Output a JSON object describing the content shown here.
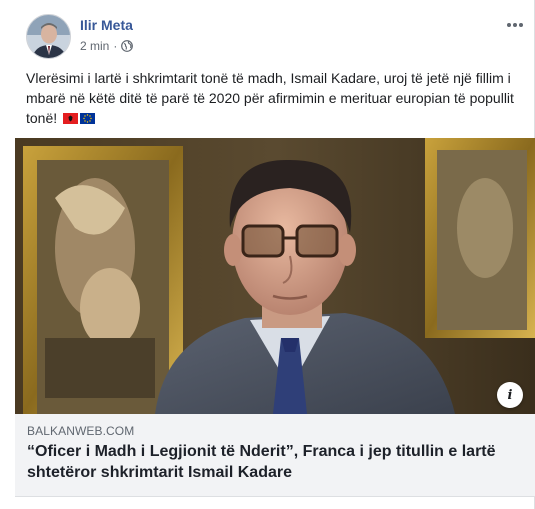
{
  "post": {
    "author": "Ilir Meta",
    "timestamp": "2 min",
    "separator": "·",
    "privacy_icon": "globe-icon",
    "more_icon": "more-options-icon",
    "text": "Vlerësimi i lartë i shkrimtarit tonë të madh, Ismail Kadare, uroj të jetë një fillim i mbarë në këtë ditë të parë të 2020 për afirmimin e merituar europian të popullit tonë!",
    "emoji": [
      "flag-albania",
      "flag-european-union"
    ]
  },
  "link_preview": {
    "domain": "BALKANWEB.COM",
    "headline": "“Oficer i Madh i Legjionit të Nderit”, Franca i jep titullin e lartë shtetëror shkrimtarit Ismail Kadare",
    "info_label": "i"
  },
  "colors": {
    "author_link": "#385898",
    "meta_text": "#606770",
    "preview_bg": "#f2f3f5",
    "albania_red": "#e41e20",
    "eu_blue": "#003399",
    "eu_gold": "#ffcc00"
  }
}
